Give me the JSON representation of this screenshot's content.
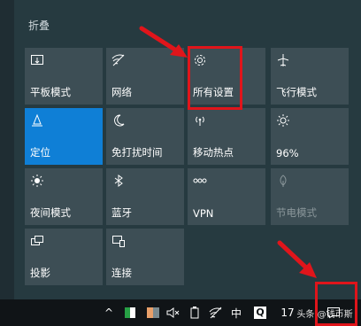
{
  "panel": {
    "collapse_label": "折叠",
    "tiles": [
      {
        "label": "平板模式",
        "icon": "tablet-mode-icon",
        "state": "normal"
      },
      {
        "label": "网络",
        "icon": "network-icon",
        "state": "normal"
      },
      {
        "label": "所有设置",
        "icon": "settings-gear-icon",
        "state": "normal"
      },
      {
        "label": "飞行模式",
        "icon": "airplane-icon",
        "state": "normal"
      },
      {
        "label": "定位",
        "icon": "location-icon",
        "state": "active"
      },
      {
        "label": "免打扰时间",
        "icon": "moon-icon",
        "state": "normal"
      },
      {
        "label": "移动热点",
        "icon": "hotspot-icon",
        "state": "normal"
      },
      {
        "label": "96%",
        "icon": "brightness-icon",
        "state": "normal"
      },
      {
        "label": "夜间模式",
        "icon": "night-light-icon",
        "state": "normal"
      },
      {
        "label": "蓝牙",
        "icon": "bluetooth-icon",
        "state": "normal"
      },
      {
        "label": "VPN",
        "icon": "vpn-icon",
        "state": "normal"
      },
      {
        "label": "节电模式",
        "icon": "battery-saver-icon",
        "state": "disabled"
      },
      {
        "label": "投影",
        "icon": "project-icon",
        "state": "normal"
      },
      {
        "label": "连接",
        "icon": "connect-icon",
        "state": "normal"
      }
    ]
  },
  "taskbar": {
    "chevron": "^",
    "ime_label": "中",
    "clock_partial": "17",
    "watermark": "头条 @钱币斯"
  },
  "colors": {
    "tile": "#3d4e55",
    "active_tile": "#0f7fd6",
    "highlight": "#e0151b",
    "taskbar": "#101417"
  }
}
